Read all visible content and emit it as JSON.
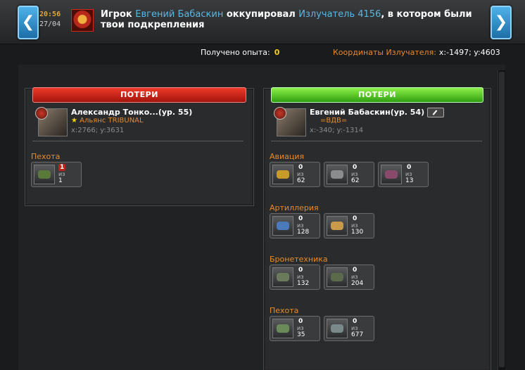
{
  "event": {
    "time": "20:56",
    "date": "27/04",
    "msg_prefix": "Игрок",
    "player": "Евгений Бабаскин",
    "msg_middle": "оккупировал",
    "target": "Излучатель 4156",
    "msg_suffix": ", в котором были твои подкрепления"
  },
  "stats": {
    "exp_label": "Получено опыта:",
    "exp_value": "0",
    "coord_label": "Координаты Излучателя:",
    "coord_value": "x:-1497; y:4603"
  },
  "left_panel": {
    "header": "ПОТЕРИ",
    "player_name": "Александр Тонко...(ур. 55)",
    "alliance": "Альянс TRIBUNAL",
    "coords": "x:2766; y:3631",
    "categories": [
      {
        "name": "Пехота",
        "units": [
          {
            "lost": "1",
            "of": "из",
            "total": "1",
            "color": "#5a7a3a"
          }
        ]
      }
    ]
  },
  "right_panel": {
    "header": "ПОТЕРИ",
    "player_name": "Евгений Бабаскин(ур. 54)",
    "alliance": "=ВДВ=",
    "coords": "x:-340; y:-1314",
    "categories": [
      {
        "name": "Авиация",
        "units": [
          {
            "lost": "0",
            "of": "из",
            "total": "62",
            "color": "#c89a2a"
          },
          {
            "lost": "0",
            "of": "из",
            "total": "62",
            "color": "#8a8c8e"
          },
          {
            "lost": "0",
            "of": "из",
            "total": "13",
            "color": "#8a4a6a"
          }
        ]
      },
      {
        "name": "Артиллерия",
        "units": [
          {
            "lost": "0",
            "of": "из",
            "total": "128",
            "color": "#4a7aba"
          },
          {
            "lost": "0",
            "of": "из",
            "total": "130",
            "color": "#c89a4a"
          }
        ]
      },
      {
        "name": "Бронетехника",
        "units": [
          {
            "lost": "0",
            "of": "из",
            "total": "132",
            "color": "#6a7a5a"
          },
          {
            "lost": "0",
            "of": "из",
            "total": "204",
            "color": "#5a6a4a"
          }
        ]
      },
      {
        "name": "Пехота",
        "units": [
          {
            "lost": "0",
            "of": "из",
            "total": "35",
            "color": "#6a8a5a"
          },
          {
            "lost": "0",
            "of": "из",
            "total": "677",
            "color": "#7a8a8a"
          }
        ]
      }
    ]
  }
}
